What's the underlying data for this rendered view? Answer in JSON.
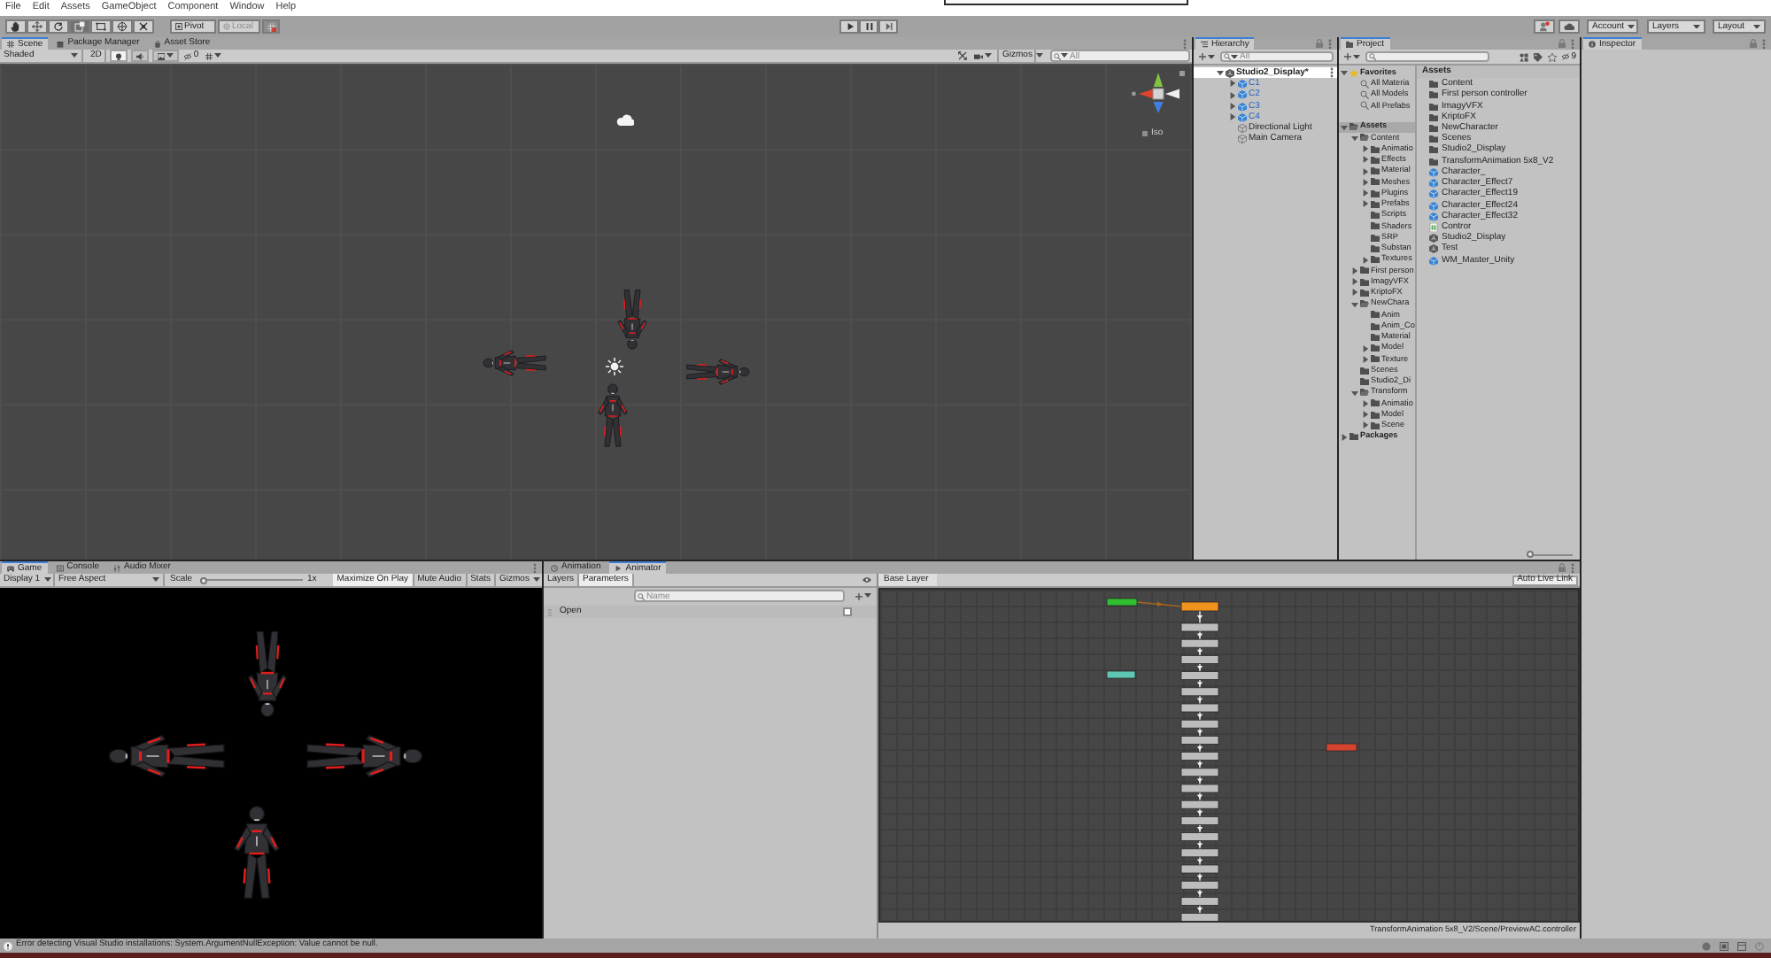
{
  "menu_bar": {
    "items": [
      "File",
      "Edit",
      "Assets",
      "GameObject",
      "Component",
      "Window",
      "Help"
    ]
  },
  "toolbar": {
    "tools": [
      {
        "kind": "hand",
        "selected": false
      },
      {
        "kind": "move",
        "selected": false
      },
      {
        "kind": "rotate",
        "selected": false
      },
      {
        "kind": "scale",
        "selected": true
      },
      {
        "kind": "rect",
        "selected": false
      },
      {
        "kind": "transform",
        "selected": false
      },
      {
        "kind": "custom",
        "selected": false
      }
    ],
    "pivot": {
      "label": "Pivot",
      "disabled": false
    },
    "handle_space": {
      "label": "Local",
      "disabled": true
    },
    "play_controls": [
      {
        "kind": "play"
      },
      {
        "kind": "pause"
      },
      {
        "kind": "step"
      }
    ],
    "account": "Account",
    "layers": "Layers",
    "layout": "Layout"
  },
  "scene_panel": {
    "tabs": [
      {
        "label": "Scene",
        "kind": "scene",
        "selected": true
      },
      {
        "label": "Package Manager",
        "kind": "package_manager",
        "selected": false
      },
      {
        "label": "Asset Store",
        "kind": "asset_store",
        "selected": false
      }
    ],
    "toolbar": {
      "shading": "Shaded",
      "mode_2d": "2D",
      "toggles": [
        {
          "kind": "lighting",
          "on": true
        },
        {
          "kind": "audio",
          "on": false
        },
        {
          "kind": "effects",
          "on": false
        }
      ],
      "hidden_count": "0",
      "gizmos": "Gizmos",
      "search_placeholder": "All"
    },
    "view_label": "Iso"
  },
  "hierarchy": {
    "tabs": [
      {
        "label": "Hierarchy",
        "kind": "hierarchy",
        "selected": true
      }
    ],
    "search_placeholder": "All",
    "items": [
      {
        "label": "Studio2_Display*",
        "kind": "scene",
        "expanded": true,
        "selected": true,
        "children": [
          {
            "label": "C1",
            "kind": "prefab",
            "expanded": false,
            "selected": false
          },
          {
            "label": "C2",
            "kind": "prefab",
            "expanded": false,
            "selected": false
          },
          {
            "label": "C3",
            "kind": "prefab",
            "expanded": false,
            "selected": false
          },
          {
            "label": "C4",
            "kind": "prefab",
            "expanded": false,
            "selected": false
          },
          {
            "label": "Directional Light",
            "kind": "object",
            "selected": false
          },
          {
            "label": "Main Camera",
            "kind": "object",
            "selected": false
          }
        ]
      }
    ]
  },
  "project": {
    "tabs": [
      {
        "label": "Project",
        "kind": "project",
        "selected": true
      }
    ],
    "hidden_count": "9",
    "tree": [
      {
        "label": "Favorites",
        "kind": "favorites",
        "expanded": true,
        "selected": false,
        "children": [
          {
            "label": "All Materia",
            "kind": "search",
            "selected": false
          },
          {
            "label": "All Models",
            "kind": "search",
            "selected": false
          },
          {
            "label": "All Prefabs",
            "kind": "search",
            "selected": false
          }
        ]
      },
      {
        "label": "Assets",
        "kind": "folder",
        "expanded": true,
        "selected": true,
        "children": [
          {
            "label": "Content",
            "kind": "folder",
            "expanded": true,
            "selected": false,
            "children": [
              {
                "label": "Animatio",
                "kind": "folder",
                "expanded": false,
                "selected": false
              },
              {
                "label": "Effects",
                "kind": "folder",
                "expanded": false,
                "selected": false
              },
              {
                "label": "Material",
                "kind": "folder",
                "expanded": false,
                "selected": false
              },
              {
                "label": "Meshes",
                "kind": "folder",
                "expanded": false,
                "selected": false
              },
              {
                "label": "Plugins",
                "kind": "folder",
                "expanded": false,
                "selected": false
              },
              {
                "label": "Prefabs",
                "kind": "folder",
                "expanded": false,
                "selected": false
              },
              {
                "label": "Scripts",
                "kind": "folder",
                "selected": false
              },
              {
                "label": "Shaders",
                "kind": "folder",
                "selected": false
              },
              {
                "label": "SRP",
                "kind": "folder",
                "selected": false
              },
              {
                "label": "Substan",
                "kind": "folder",
                "selected": false
              },
              {
                "label": "Textures",
                "kind": "folder",
                "expanded": false,
                "selected": false
              }
            ]
          },
          {
            "label": "First person",
            "kind": "folder",
            "expanded": false,
            "selected": false
          },
          {
            "label": "ImagyVFX",
            "kind": "folder",
            "expanded": false,
            "selected": false
          },
          {
            "label": "KriptoFX",
            "kind": "folder",
            "expanded": false,
            "selected": false
          },
          {
            "label": "NewChara",
            "kind": "folder",
            "expanded": true,
            "selected": false,
            "children": [
              {
                "label": "Anim",
                "kind": "folder",
                "selected": false
              },
              {
                "label": "Anim_Co",
                "kind": "folder",
                "selected": false
              },
              {
                "label": "Material",
                "kind": "folder",
                "selected": false
              },
              {
                "label": "Model",
                "kind": "folder",
                "expanded": false,
                "selected": false
              },
              {
                "label": "Texture",
                "kind": "folder",
                "expanded": false,
                "selected": false
              }
            ]
          },
          {
            "label": "Scenes",
            "kind": "folder",
            "selected": false
          },
          {
            "label": "Studio2_Di",
            "kind": "folder",
            "selected": false
          },
          {
            "label": "Transform",
            "kind": "folder",
            "expanded": true,
            "selected": false,
            "children": [
              {
                "label": "Animatio",
                "kind": "folder",
                "expanded": false,
                "selected": false
              },
              {
                "label": "Model",
                "kind": "folder",
                "expanded": false,
                "selected": false
              },
              {
                "label": "Scene",
                "kind": "folder",
                "expanded": false,
                "selected": false
              }
            ]
          }
        ]
      },
      {
        "label": "Packages",
        "kind": "folder",
        "expanded": false,
        "selected": false
      }
    ],
    "list_header": "Assets",
    "items": [
      {
        "label": "Content",
        "kind": "folder"
      },
      {
        "label": "First person controller",
        "kind": "folder"
      },
      {
        "label": "ImagyVFX",
        "kind": "folder"
      },
      {
        "label": "KriptoFX",
        "kind": "folder"
      },
      {
        "label": "NewCharacter",
        "kind": "folder"
      },
      {
        "label": "Scenes",
        "kind": "folder"
      },
      {
        "label": "Studio2_Display",
        "kind": "folder"
      },
      {
        "label": "TransformAnimation 5x8_V2",
        "kind": "folder"
      },
      {
        "label": "Character_",
        "kind": "prefab"
      },
      {
        "label": "Character_Effect7",
        "kind": "prefab"
      },
      {
        "label": "Character_Effect19",
        "kind": "prefab"
      },
      {
        "label": "Character_Effect24",
        "kind": "prefab"
      },
      {
        "label": "Character_Effect32",
        "kind": "prefab"
      },
      {
        "label": "Contror",
        "kind": "script"
      },
      {
        "label": "Studio2_Display",
        "kind": "scene"
      },
      {
        "label": "Test",
        "kind": "scene"
      },
      {
        "label": "WM_Master_Unity",
        "kind": "prefab"
      }
    ],
    "icon_size": {
      "level": 0
    }
  },
  "inspector": {
    "tabs": [
      {
        "label": "Inspector",
        "kind": "inspector",
        "selected": true
      }
    ]
  },
  "game_panel": {
    "tabs": [
      {
        "label": "Game",
        "kind": "game",
        "selected": true
      },
      {
        "label": "Console",
        "kind": "console",
        "selected": false
      },
      {
        "label": "Audio Mixer",
        "kind": "audio_mixer",
        "selected": false
      }
    ],
    "toolbar": {
      "display": "Display 1",
      "aspect": "Free Aspect",
      "scale_label": "Scale",
      "scale": {
        "level": 0
      },
      "scale_reading": "1x",
      "toggles": [
        {
          "label": "Maximize On Play",
          "on": true
        },
        {
          "label": "Mute Audio",
          "on": false
        },
        {
          "label": "Stats",
          "on": false
        }
      ],
      "gizmos": "Gizmos"
    }
  },
  "animator_panel": {
    "tabs": [
      {
        "label": "Animation",
        "kind": "animation",
        "selected": false
      },
      {
        "label": "Animator",
        "kind": "animator",
        "selected": true
      }
    ],
    "sub_tabs": [
      {
        "label": "Layers",
        "selected": false
      },
      {
        "label": "Parameters",
        "selected": true
      }
    ],
    "search_placeholder": "Name",
    "parameters": [
      {
        "name": "Open",
        "kind": "bool",
        "checked": false
      }
    ],
    "breadcrumb": "Base Layer",
    "auto_live_link": "Auto Live Link",
    "nodes": [
      {
        "kind": "entry",
        "color": "#2fbf2f"
      },
      {
        "kind": "default",
        "color": "#f0921e"
      },
      {
        "kind": "any_state",
        "color": "#5ec7b4"
      },
      {
        "kind": "exit",
        "color": "#d6432f"
      },
      {
        "kind": "state",
        "color": "#bcbcbc"
      },
      {
        "kind": "state",
        "color": "#bcbcbc"
      },
      {
        "kind": "state",
        "color": "#bcbcbc"
      },
      {
        "kind": "state",
        "color": "#bcbcbc"
      },
      {
        "kind": "state",
        "color": "#bcbcbc"
      },
      {
        "kind": "state",
        "color": "#bcbcbc"
      },
      {
        "kind": "state",
        "color": "#bcbcbc"
      },
      {
        "kind": "state",
        "color": "#bcbcbc"
      },
      {
        "kind": "state",
        "color": "#bcbcbc"
      },
      {
        "kind": "state",
        "color": "#bcbcbc"
      },
      {
        "kind": "state",
        "color": "#bcbcbc"
      },
      {
        "kind": "state",
        "color": "#bcbcbc"
      },
      {
        "kind": "state",
        "color": "#bcbcbc"
      },
      {
        "kind": "state",
        "color": "#bcbcbc"
      },
      {
        "kind": "state",
        "color": "#bcbcbc"
      },
      {
        "kind": "state",
        "color": "#bcbcbc"
      },
      {
        "kind": "state",
        "color": "#bcbcbc"
      },
      {
        "kind": "state",
        "color": "#bcbcbc"
      },
      {
        "kind": "state",
        "color": "#bcbcbc"
      }
    ],
    "controller_path": "TransformAnimation 5x8_V2/Scene/PreviewAC.controller"
  },
  "status_bar": {
    "message": "Error detecting Visual Studio installations: System.ArgumentNullException: Value cannot be null."
  }
}
